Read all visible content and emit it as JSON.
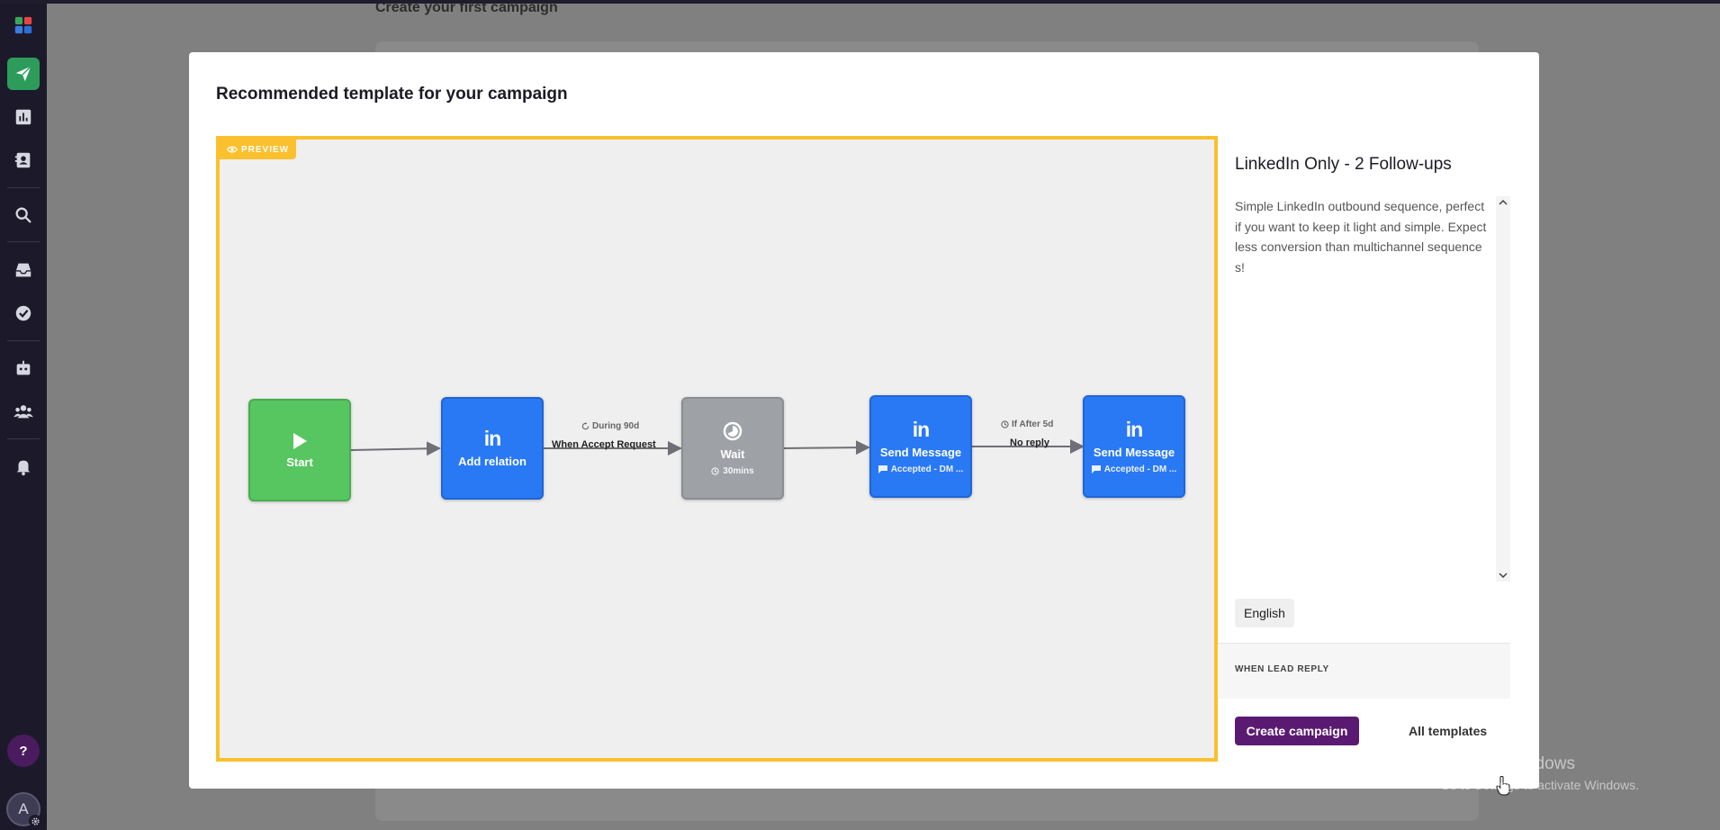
{
  "background": {
    "page_title": "Create your first campaign"
  },
  "sidebar": {
    "items": [
      {
        "icon": "send-icon",
        "active": true
      },
      {
        "icon": "chart-icon"
      },
      {
        "icon": "contacts-icon"
      },
      {
        "icon": "search-icon"
      },
      {
        "icon": "inbox-icon"
      },
      {
        "icon": "check-circle-icon"
      },
      {
        "icon": "robot-icon"
      },
      {
        "icon": "team-icon"
      },
      {
        "icon": "bell-icon"
      }
    ],
    "help_label": "?",
    "avatar_initial": "A"
  },
  "modal": {
    "title": "Recommended template for your campaign",
    "preview_badge": "PREVIEW",
    "flow": {
      "nodes": [
        {
          "label": "Start",
          "type": "start",
          "color": "#57c560"
        },
        {
          "label": "Add relation",
          "type": "linkedin",
          "color": "#2979f5"
        },
        {
          "label": "Wait",
          "sub": "30mins",
          "type": "wait",
          "color": "#9ea1a6"
        },
        {
          "label": "Send Message",
          "sub": "Accepted - DM ...",
          "type": "linkedin",
          "color": "#2979f5"
        },
        {
          "label": "Send Message",
          "sub": "Accepted - DM ...",
          "type": "linkedin",
          "color": "#2979f5"
        }
      ],
      "edges": [
        {
          "condition": "During 90d",
          "label": "When Accept Request"
        },
        {
          "condition": "If After 5d",
          "label": "No reply"
        }
      ]
    },
    "template": {
      "name": "LinkedIn Only - 2 Follow-ups",
      "description": "Simple LinkedIn outbound sequence, perfect if you want to keep it light and simple. Expect less conversion than multichannel sequences!",
      "language": "English",
      "lead_reply_heading": "WHEN LEAD REPLY"
    },
    "buttons": {
      "create": "Create campaign",
      "all_templates": "All templates"
    }
  },
  "os_watermark": {
    "line1": "Activate Windows",
    "line2": "Go to Settings to activate Windows."
  },
  "colors": {
    "accent_purple": "#5a1a72",
    "preview_border": "#fbc02d",
    "sidebar_active": "#2d9c5b"
  }
}
